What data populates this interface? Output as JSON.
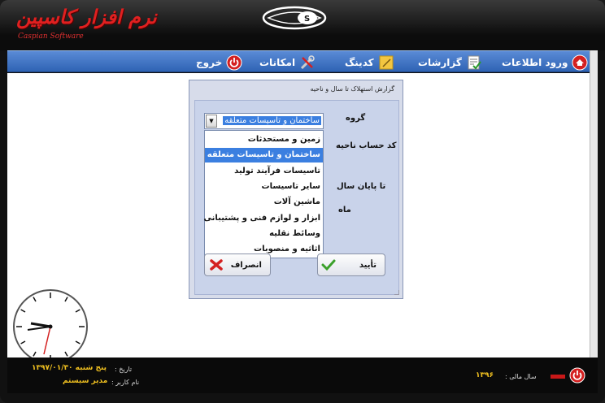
{
  "app": {
    "logo_text": "نرم افزار کاسپین",
    "logo_subtitle": "Caspian Software"
  },
  "menu": {
    "items": [
      {
        "label": "ورود اطلاعات",
        "icon": "home-icon"
      },
      {
        "label": "گزارشات",
        "icon": "report-icon"
      },
      {
        "label": "کدینگ",
        "icon": "coding-icon"
      },
      {
        "label": "امکانات",
        "icon": "tools-icon"
      },
      {
        "label": "خروج",
        "icon": "power-icon"
      }
    ]
  },
  "dialog": {
    "title": "گزارش استهلاک تا سال و ناحیه",
    "fields": {
      "group_label": "گروه",
      "area_code_label": "کد حساب ناحیه",
      "to_year_end_label": "تا پایان سال",
      "month_label": "ماه"
    },
    "combo": {
      "selected": "ساختمان و تاسیسات متعلقه"
    },
    "dropdown_items": [
      "زمین و مستحدثات",
      "ساختمان و تاسیسات متعلقه",
      "تاسیسات فرآیند تولید",
      "سایر تاسیسات",
      "ماشین آلات",
      "ابزار و لوازم فنی و پشتیبانی",
      "وسائط نقلیه",
      "اثاثیه و منصوبات"
    ],
    "selected_index": 1,
    "buttons": {
      "confirm": "تأیید",
      "cancel": "انصراف"
    }
  },
  "status": {
    "date_label": "تاریخ :",
    "date_value": "پنج شنبه ۱۳۹۷/۰۱/۳۰",
    "user_label": "نام کاربر :",
    "user_value": "مدیر سیستم",
    "fiscal_year_label": "سال مالی :",
    "fiscal_year_value": "۱۳۹۶"
  },
  "colors": {
    "menubar": "#3a6fc4",
    "selection": "#3b7fe0",
    "status_value": "#f0c020",
    "logo": "#e02020"
  }
}
